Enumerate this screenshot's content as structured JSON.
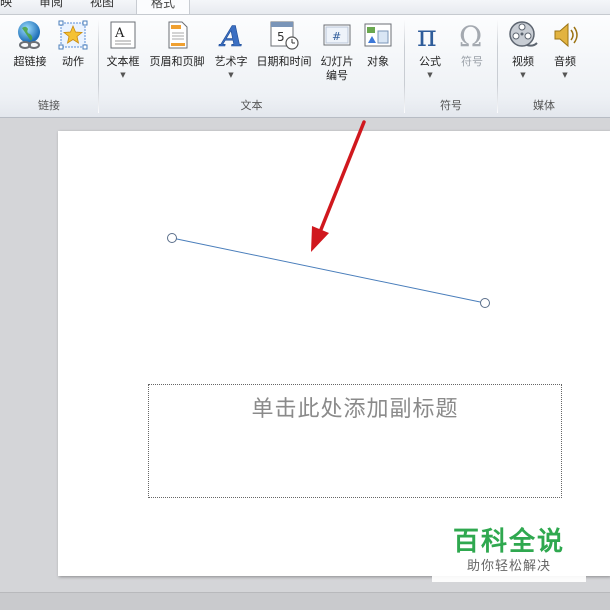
{
  "tabs": [
    "映",
    "审阅",
    "视图",
    "格式"
  ],
  "groups": {
    "links": {
      "label": "链接",
      "buttons": [
        {
          "label": "超链接",
          "icon": "globe-chain-icon"
        },
        {
          "label": "动作",
          "icon": "star-action-icon"
        }
      ]
    },
    "text": {
      "label": "文本",
      "buttons": [
        {
          "label": "文本框",
          "icon": "textbox-icon",
          "dropdown": true
        },
        {
          "label": "页眉和页脚",
          "icon": "header-footer-icon"
        },
        {
          "label": "艺术字",
          "icon": "wordart-icon",
          "dropdown": true
        },
        {
          "label": "日期和时间",
          "icon": "calendar-clock-icon"
        },
        {
          "label": "幻灯片",
          "label2": "编号",
          "icon": "slide-number-icon"
        },
        {
          "label": "对象",
          "icon": "object-icon"
        }
      ]
    },
    "symbols": {
      "label": "符号",
      "buttons": [
        {
          "label": "公式",
          "icon": "pi-icon",
          "dropdown": true
        },
        {
          "label": "符号",
          "icon": "omega-icon",
          "disabled": true
        }
      ]
    },
    "media": {
      "label": "媒体",
      "buttons": [
        {
          "label": "视频",
          "icon": "film-reel-icon",
          "dropdown": true
        },
        {
          "label": "音频",
          "icon": "speaker-icon",
          "dropdown": true
        }
      ]
    }
  },
  "slide": {
    "subtitle_placeholder": "单击此处添加副标题"
  },
  "watermark": {
    "title": "百科全说",
    "subtitle": "助你轻松解决"
  },
  "colors": {
    "line": "#4a7ebb",
    "arrow": "#d0181e",
    "watermark_green": "#2fa84f"
  }
}
